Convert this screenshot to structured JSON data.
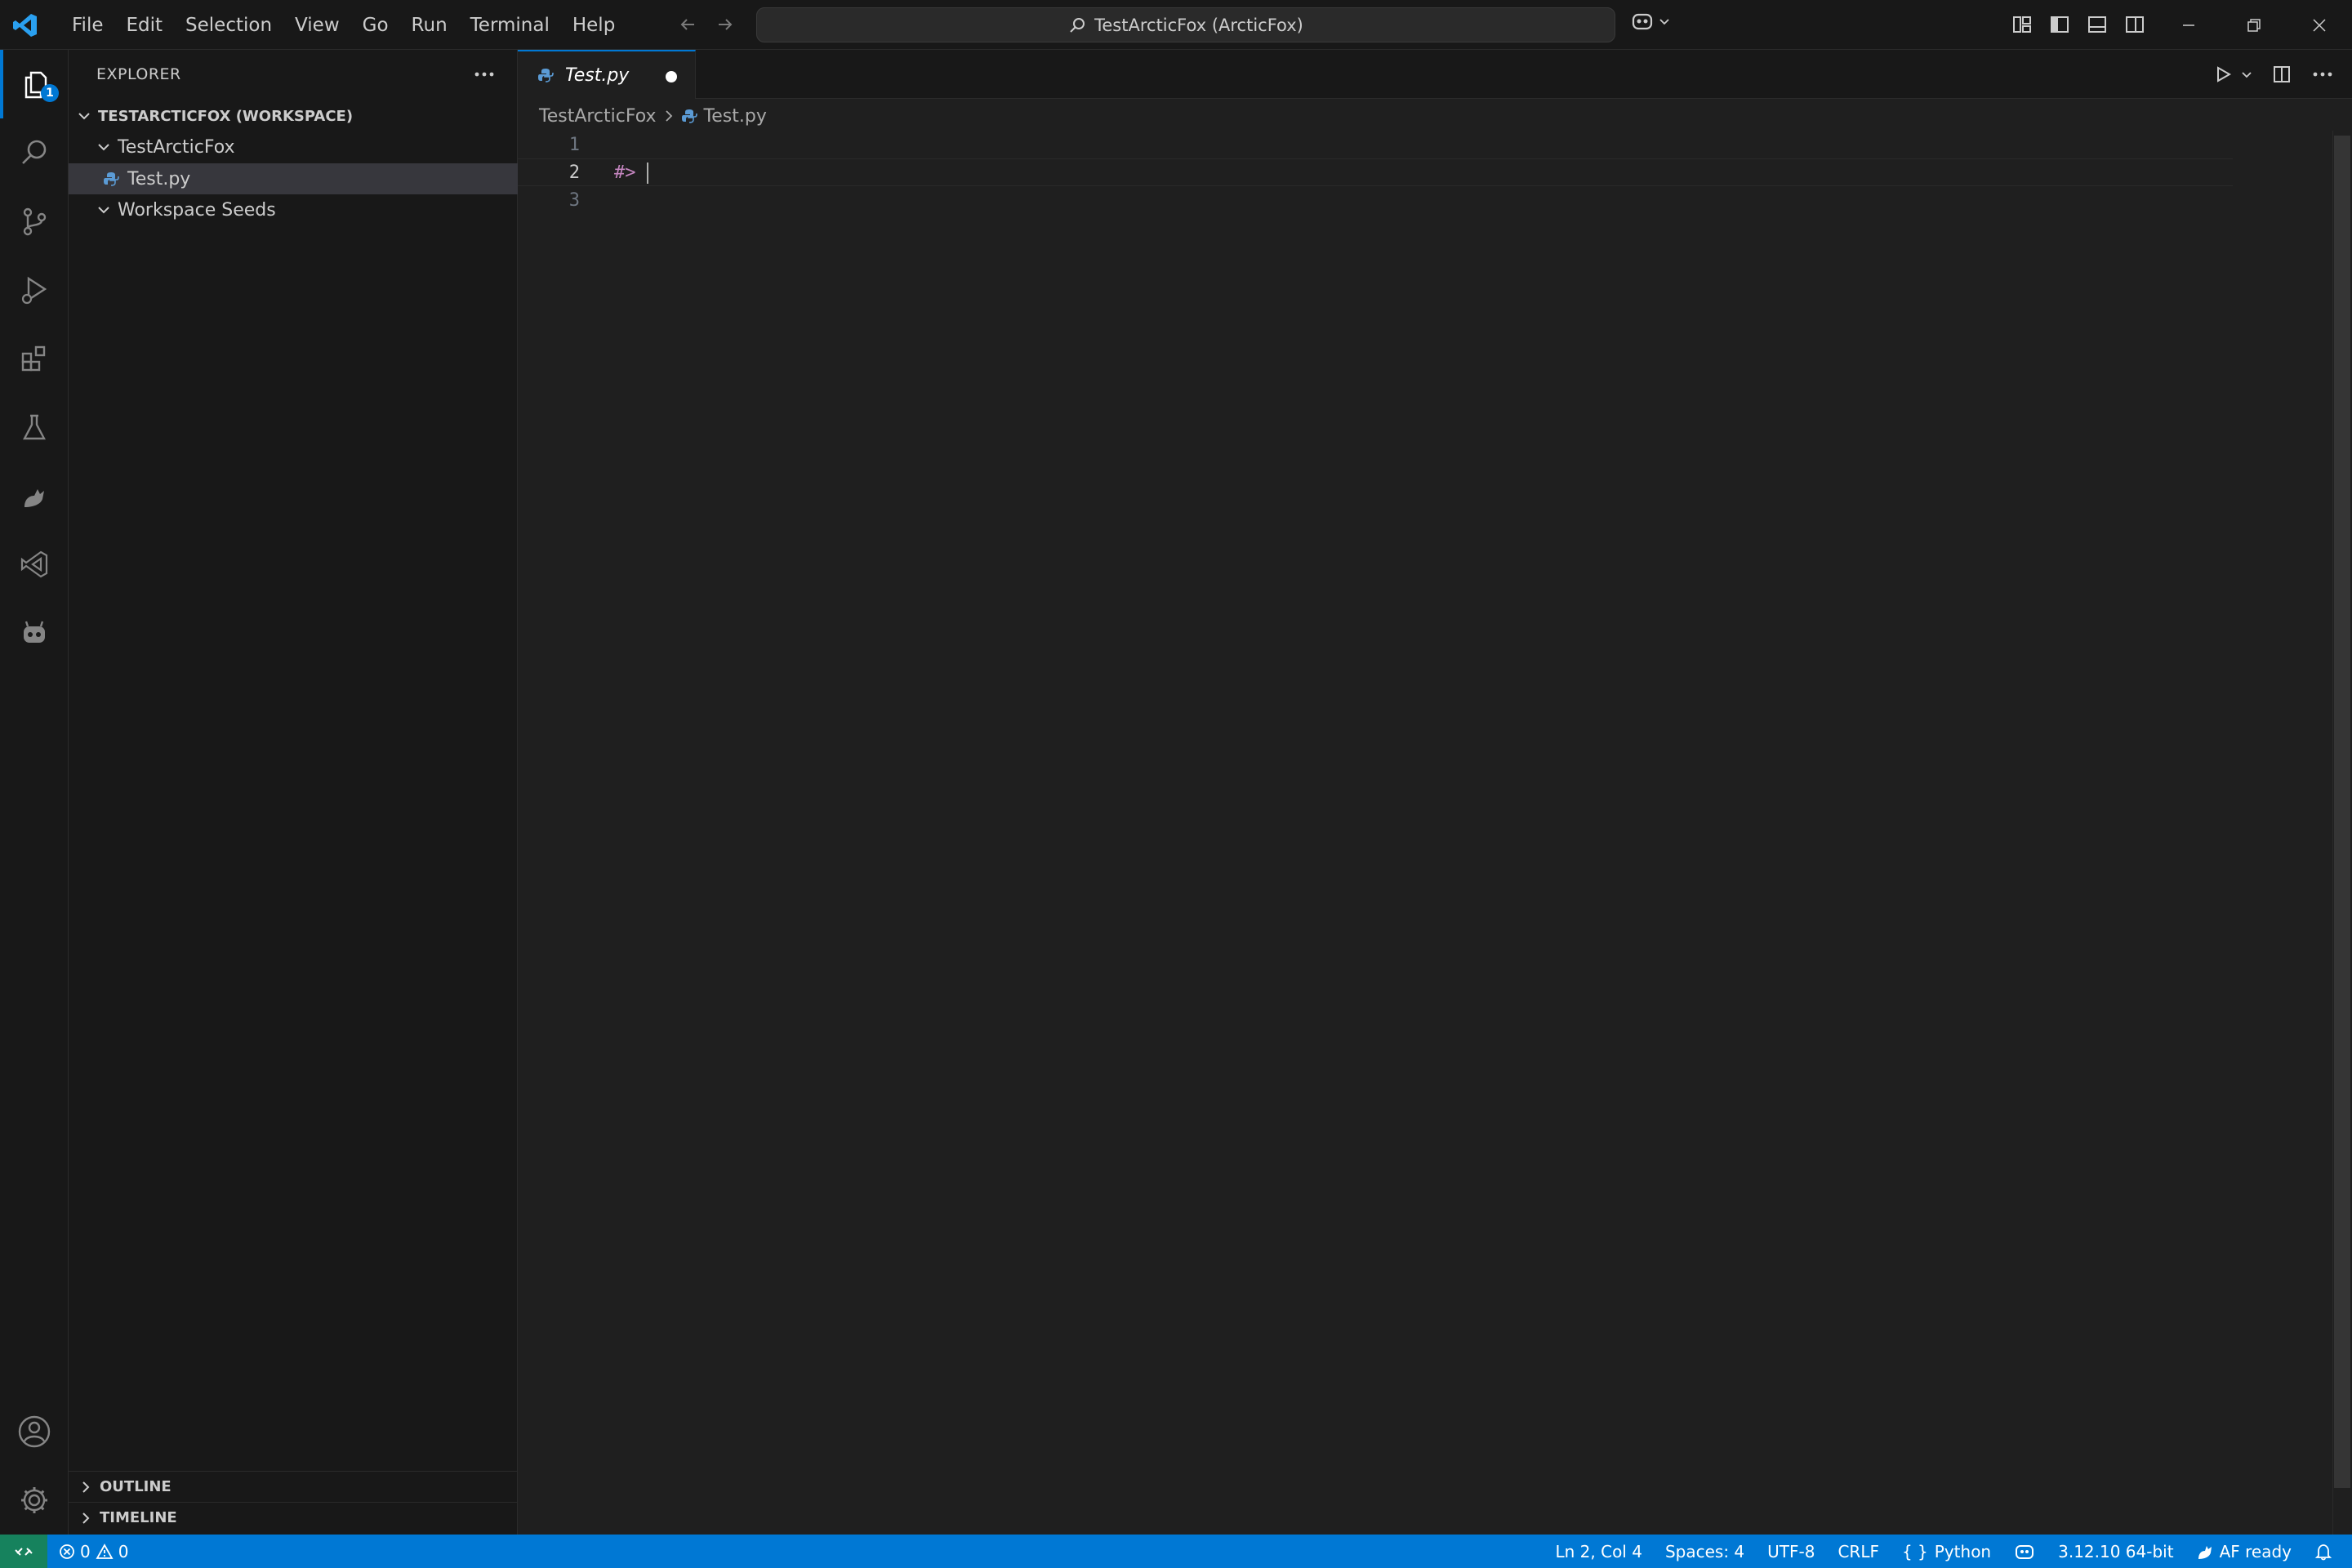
{
  "menu": [
    "File",
    "Edit",
    "Selection",
    "View",
    "Go",
    "Run",
    "Terminal",
    "Help"
  ],
  "command_center": {
    "text": "TestArcticFox (ArcticFox)"
  },
  "activity": {
    "explorer_badge": "1"
  },
  "sidebar": {
    "title": "EXPLORER",
    "workspace": "TESTARCTICFOX (WORKSPACE)",
    "folder": "TestArcticFox",
    "file": "Test.py",
    "folder2": "Workspace Seeds",
    "outline": "OUTLINE",
    "timeline": "TIMELINE"
  },
  "tab": {
    "label": "Test.py"
  },
  "breadcrumb": {
    "folder": "TestArcticFox",
    "file": "Test.py"
  },
  "editor": {
    "lines": [
      {
        "number": "1",
        "text": ""
      },
      {
        "number": "2",
        "text": "#>"
      },
      {
        "number": "3",
        "text": ""
      }
    ]
  },
  "status": {
    "errors": "0",
    "warnings": "0",
    "position": "Ln 2, Col 4",
    "spaces": "Spaces: 4",
    "encoding": "UTF-8",
    "eol": "CRLF",
    "language": "Python",
    "interpreter": "3.12.10 64-bit",
    "af": "AF ready"
  },
  "colors": {
    "accent": "#0078d4",
    "remote": "#16825d",
    "background": "#1f1f1f",
    "sidebar": "#181818"
  }
}
